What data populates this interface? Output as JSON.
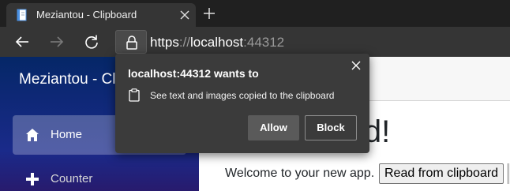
{
  "browser": {
    "tab": {
      "title": "Meziantou - Clipboard"
    },
    "address": {
      "scheme": "https",
      "separator": "://",
      "host": "localhost",
      "port": ":44312"
    }
  },
  "app": {
    "brand": "Meziantou - Clipboard",
    "nav": [
      {
        "label": "Home",
        "icon": "home-icon",
        "active": true
      },
      {
        "label": "Counter",
        "icon": "plus-icon",
        "active": false
      }
    ],
    "heading_fragment": "ld!",
    "welcome": "Welcome to your new app.",
    "read_button": "Read from clipboard"
  },
  "permission_popup": {
    "title": "localhost:44312 wants to",
    "message": "See text and images copied to the clipboard",
    "allow": "Allow",
    "block": "Block"
  },
  "colors": {
    "tab_strip": "#202020",
    "toolbar": "#353535",
    "popup": "#3b3b3b",
    "sidebar_top": "#052767",
    "sidebar_bottom": "#3a0647"
  }
}
